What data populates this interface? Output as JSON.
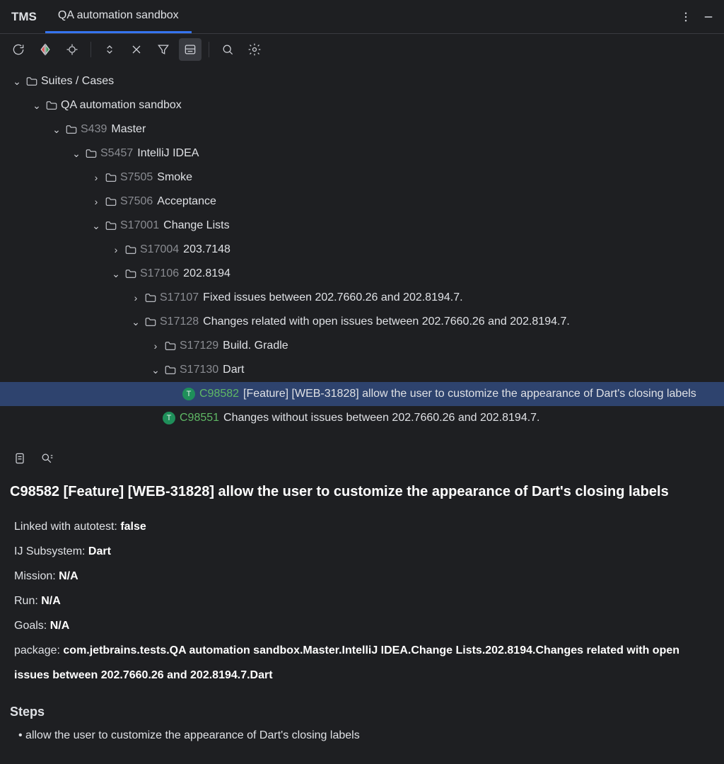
{
  "header": {
    "brand": "TMS",
    "tabs": [
      {
        "label": "QA automation sandbox",
        "active": true
      }
    ]
  },
  "colors": {
    "accent": "#3574f0",
    "caseGreen": "#5fb865",
    "badgeGreen": "#1f8f5a",
    "bg": "#1e1f22",
    "selection": "#2e436e"
  },
  "tree": [
    {
      "depth": 0,
      "expand": "open",
      "kind": "folder",
      "label": "Suites / Cases"
    },
    {
      "depth": 1,
      "expand": "open",
      "kind": "folder",
      "label": "QA automation sandbox"
    },
    {
      "depth": 2,
      "expand": "open",
      "kind": "folder",
      "sid": "S439",
      "label": "Master"
    },
    {
      "depth": 3,
      "expand": "open",
      "kind": "folder",
      "sid": "S5457",
      "label": "IntelliJ IDEA"
    },
    {
      "depth": 4,
      "expand": "closed",
      "kind": "folder",
      "sid": "S7505",
      "label": "Smoke"
    },
    {
      "depth": 4,
      "expand": "closed",
      "kind": "folder",
      "sid": "S7506",
      "label": "Acceptance"
    },
    {
      "depth": 4,
      "expand": "open",
      "kind": "folder",
      "sid": "S17001",
      "label": "Change Lists"
    },
    {
      "depth": 5,
      "expand": "closed",
      "kind": "folder",
      "sid": "S17004",
      "label": "203.7148"
    },
    {
      "depth": 5,
      "expand": "open",
      "kind": "folder",
      "sid": "S17106",
      "label": "202.8194"
    },
    {
      "depth": 6,
      "expand": "closed",
      "kind": "folder",
      "sid": "S17107",
      "label": "Fixed issues between 202.7660.26 and 202.8194.7."
    },
    {
      "depth": 6,
      "expand": "open",
      "kind": "folder",
      "sid": "S17128",
      "label": "Changes related with open issues between 202.7660.26 and 202.8194.7."
    },
    {
      "depth": 7,
      "expand": "closed",
      "kind": "folder",
      "sid": "S17129",
      "label": "Build. Gradle"
    },
    {
      "depth": 7,
      "expand": "open",
      "kind": "folder",
      "sid": "S17130",
      "label": "Dart"
    },
    {
      "depth": 8,
      "expand": "none",
      "kind": "case",
      "cid": "C98582",
      "label": "[Feature] [WEB-31828] allow the user to customize the appearance of Dart's closing labels",
      "selected": true
    },
    {
      "depth": 7,
      "expand": "none",
      "kind": "case",
      "cid": "C98551",
      "label": "Changes without issues between 202.7660.26 and 202.8194.7."
    }
  ],
  "detail": {
    "title": "C98582 [Feature] [WEB-31828] allow the user to customize the appearance of Dart's closing labels",
    "fields": [
      {
        "k": "Linked with autotest:",
        "v": "false"
      },
      {
        "k": "IJ Subsystem:",
        "v": "Dart"
      },
      {
        "k": "Mission:",
        "v": "N/A"
      },
      {
        "k": "Run:",
        "v": "N/A"
      },
      {
        "k": "Goals:",
        "v": "N/A"
      },
      {
        "k": "package:",
        "v": "com.jetbrains.tests.QA automation sandbox.Master.IntelliJ IDEA.Change Lists.202.8194.Changes related with open issues between 202.7660.26 and 202.8194.7.Dart"
      }
    ],
    "stepsHeader": "Steps",
    "steps": [
      "allow the user to customize the appearance of Dart's closing labels"
    ]
  }
}
